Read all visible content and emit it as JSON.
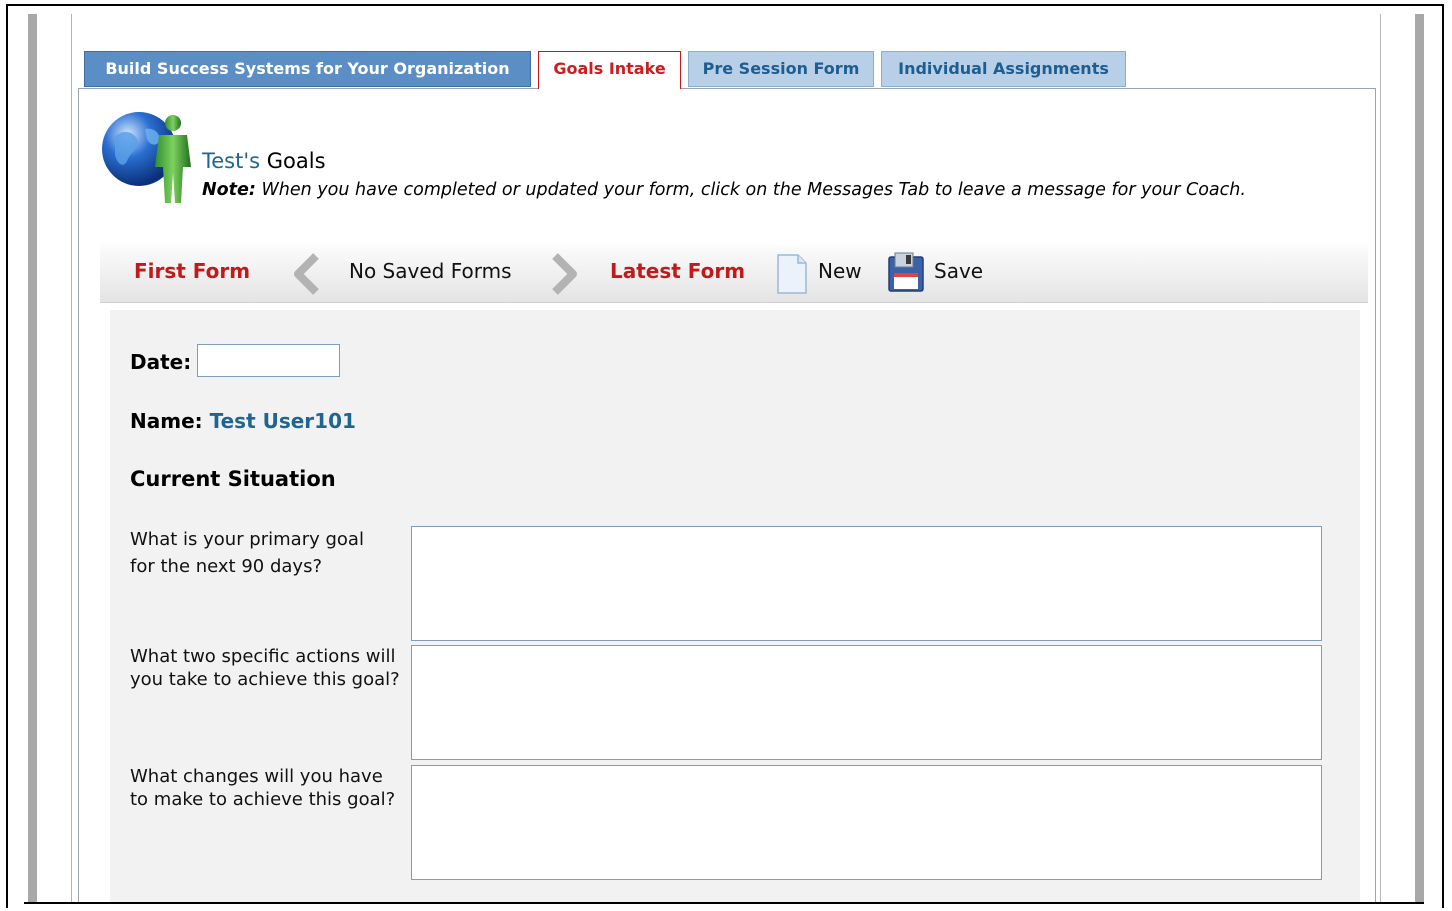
{
  "tabs": [
    {
      "label": "Build Success Systems for Your Organization",
      "state": "inactive-dark"
    },
    {
      "label": "Goals Intake",
      "state": "active"
    },
    {
      "label": "Pre Session Form",
      "state": "inactive-light"
    },
    {
      "label": "Individual Assignments",
      "state": "inactive-light"
    }
  ],
  "header": {
    "owner": "Test's",
    "title": " Goals",
    "note_label": "Note:",
    "note_text": " When you have completed or updated your form, click on the Messages Tab to leave a message for your Coach."
  },
  "toolbar": {
    "first_form": "First Form",
    "no_saved_forms": "No Saved Forms",
    "latest_form": "Latest Form",
    "new_label": "New",
    "save_label": "Save",
    "icons": [
      "globe-person-icon",
      "chevron-left-icon",
      "chevron-right-icon",
      "new-document-icon",
      "floppy-disk-icon"
    ]
  },
  "form": {
    "date_label": "Date:",
    "date_value": "",
    "name_label": "Name:",
    "name_value": "Test User101",
    "section_title": "Current Situation",
    "questions": [
      {
        "label": "What is your primary goal for the next 90 days?",
        "value": ""
      },
      {
        "label": "What two specific actions will you take to achieve this goal?",
        "value": ""
      },
      {
        "label": "What changes will you have to make to achieve this goal?",
        "value": ""
      }
    ]
  },
  "colors": {
    "accent_red": "#c11a1a",
    "link_blue": "#1e6592",
    "tab_dark": "#5b8ec4",
    "tab_light": "#b7d0e8"
  }
}
